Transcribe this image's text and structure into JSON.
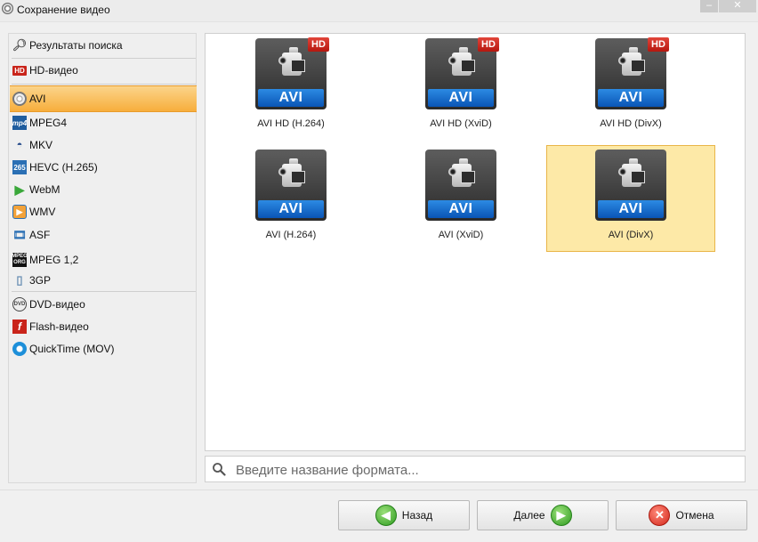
{
  "window": {
    "title": "Сохранение видео"
  },
  "sidebar": {
    "items": [
      {
        "label": "Результаты поиска",
        "icon": "search-icon"
      },
      {
        "label": "HD-видео",
        "icon": "hd-icon"
      },
      {
        "label": "AVI",
        "icon": "film-reel-icon",
        "active": true
      },
      {
        "label": "MPEG4",
        "icon": "mp4-icon"
      },
      {
        "label": "MKV",
        "icon": "mkv-icon"
      },
      {
        "label": "HEVC (H.265)",
        "icon": "hevc-icon"
      },
      {
        "label": "WebM",
        "icon": "play-icon"
      },
      {
        "label": "WMV",
        "icon": "wmv-icon"
      },
      {
        "label": "ASF",
        "icon": "asf-icon"
      },
      {
        "label": "MPEG 1,2",
        "icon": "mpeg-icon"
      },
      {
        "label": "3GP",
        "icon": "phone-icon"
      },
      {
        "label": "DVD-видео",
        "icon": "dvd-icon"
      },
      {
        "label": "Flash-видео",
        "icon": "flash-icon"
      },
      {
        "label": "QuickTime (MOV)",
        "icon": "quicktime-icon"
      }
    ]
  },
  "formats": [
    {
      "badge": "AVI",
      "hd": "HD",
      "label": "AVI HD (H.264)"
    },
    {
      "badge": "AVI",
      "hd": "HD",
      "label": "AVI HD (XviD)"
    },
    {
      "badge": "AVI",
      "hd": "HD",
      "label": "AVI HD (DivX)"
    },
    {
      "badge": "AVI",
      "label": "AVI (H.264)"
    },
    {
      "badge": "AVI",
      "label": "AVI (XviD)"
    },
    {
      "badge": "AVI",
      "label": "AVI (DivX)",
      "selected": true
    }
  ],
  "search": {
    "placeholder": "Введите название формата..."
  },
  "buttons": {
    "back": "Назад",
    "next": "Далее",
    "cancel": "Отмена"
  },
  "colors": {
    "accent": "#f7ae3c",
    "selected_tile": "#fde9a7",
    "format_bar": "#1a6fd0",
    "hd_badge": "#c9241a"
  }
}
